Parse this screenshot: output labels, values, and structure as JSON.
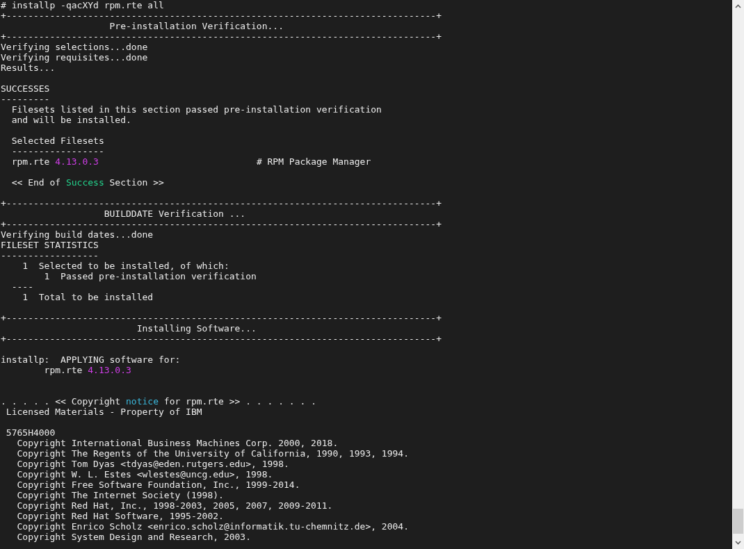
{
  "terminal": {
    "lines": [
      {
        "kind": "text",
        "segments": [
          {
            "text": "# installp -qacXYd rpm.rte all"
          }
        ]
      },
      {
        "kind": "text",
        "segments": [
          {
            "text": "+-------------------------------------------------------------------------------+"
          }
        ]
      },
      {
        "kind": "text",
        "segments": [
          {
            "text": "                    Pre-installation Verification..."
          }
        ]
      },
      {
        "kind": "text",
        "segments": [
          {
            "text": "+-------------------------------------------------------------------------------+"
          }
        ]
      },
      {
        "kind": "text",
        "segments": [
          {
            "text": "Verifying selections...done"
          }
        ]
      },
      {
        "kind": "text",
        "segments": [
          {
            "text": "Verifying requisites...done"
          }
        ]
      },
      {
        "kind": "text",
        "segments": [
          {
            "text": "Results..."
          }
        ]
      },
      {
        "kind": "blank"
      },
      {
        "kind": "text",
        "segments": [
          {
            "text": "SUCCESSES"
          }
        ]
      },
      {
        "kind": "text",
        "segments": [
          {
            "text": "---------"
          }
        ]
      },
      {
        "kind": "text",
        "segments": [
          {
            "text": "  Filesets listed in this section passed pre-installation verification"
          }
        ]
      },
      {
        "kind": "text",
        "segments": [
          {
            "text": "  and will be installed."
          }
        ]
      },
      {
        "kind": "blank"
      },
      {
        "kind": "text",
        "segments": [
          {
            "text": "  Selected Filesets"
          }
        ]
      },
      {
        "kind": "text",
        "segments": [
          {
            "text": "  -----------------"
          }
        ]
      },
      {
        "kind": "text",
        "segments": [
          {
            "text": "  rpm.rte "
          },
          {
            "text": "4.13.0.3",
            "color": "#d03ee8"
          },
          {
            "text": "                             # RPM Package Manager"
          }
        ]
      },
      {
        "kind": "blank"
      },
      {
        "kind": "text",
        "segments": [
          {
            "text": "  << End of "
          },
          {
            "text": "Success",
            "color": "#23d18b"
          },
          {
            "text": " Section >>"
          }
        ]
      },
      {
        "kind": "blank"
      },
      {
        "kind": "text",
        "segments": [
          {
            "text": "+-------------------------------------------------------------------------------+"
          }
        ]
      },
      {
        "kind": "text",
        "segments": [
          {
            "text": "                   BUILDDATE Verification ..."
          }
        ]
      },
      {
        "kind": "text",
        "segments": [
          {
            "text": "+-------------------------------------------------------------------------------+"
          }
        ]
      },
      {
        "kind": "text",
        "segments": [
          {
            "text": "Verifying build dates...done"
          }
        ]
      },
      {
        "kind": "text",
        "segments": [
          {
            "text": "FILESET STATISTICS"
          }
        ]
      },
      {
        "kind": "text",
        "segments": [
          {
            "text": "------------------"
          }
        ]
      },
      {
        "kind": "text",
        "segments": [
          {
            "text": "    1  Selected to be installed, of which:"
          }
        ]
      },
      {
        "kind": "text",
        "segments": [
          {
            "text": "        1  Passed pre-installation verification"
          }
        ]
      },
      {
        "kind": "text",
        "segments": [
          {
            "text": "  ----"
          }
        ]
      },
      {
        "kind": "text",
        "segments": [
          {
            "text": "    1  Total to be installed"
          }
        ]
      },
      {
        "kind": "blank"
      },
      {
        "kind": "text",
        "segments": [
          {
            "text": "+-------------------------------------------------------------------------------+"
          }
        ]
      },
      {
        "kind": "text",
        "segments": [
          {
            "text": "                         Installing Software..."
          }
        ]
      },
      {
        "kind": "text",
        "segments": [
          {
            "text": "+-------------------------------------------------------------------------------+"
          }
        ]
      },
      {
        "kind": "blank"
      },
      {
        "kind": "text",
        "segments": [
          {
            "text": "installp:  APPLYING software for:"
          }
        ]
      },
      {
        "kind": "text",
        "segments": [
          {
            "text": "        rpm.rte "
          },
          {
            "text": "4.13.0.3",
            "color": "#d03ee8"
          }
        ]
      },
      {
        "kind": "blank"
      },
      {
        "kind": "blank"
      },
      {
        "kind": "text",
        "segments": [
          {
            "text": ". . . . . << Copyright "
          },
          {
            "text": "notice",
            "color": "#3bb8dc"
          },
          {
            "text": " for rpm.rte >> . . . . . . ."
          }
        ]
      },
      {
        "kind": "text",
        "segments": [
          {
            "text": " Licensed Materials - Property of IBM"
          }
        ]
      },
      {
        "kind": "blank"
      },
      {
        "kind": "text",
        "segments": [
          {
            "text": " 5765H4000"
          }
        ]
      },
      {
        "kind": "text",
        "segments": [
          {
            "text": "   Copyright International Business Machines Corp. 2000, 2018."
          }
        ]
      },
      {
        "kind": "text",
        "segments": [
          {
            "text": "   Copyright The Regents of the University of California, 1990, 1993, 1994."
          }
        ]
      },
      {
        "kind": "text",
        "segments": [
          {
            "text": "   Copyright Tom Dyas <tdyas@eden.rutgers.edu>, 1998."
          }
        ]
      },
      {
        "kind": "text",
        "segments": [
          {
            "text": "   Copyright W. L. Estes <wlestes@uncg.edu>, 1998."
          }
        ]
      },
      {
        "kind": "text",
        "segments": [
          {
            "text": "   Copyright Free Software Foundation, Inc., 1999-2014."
          }
        ]
      },
      {
        "kind": "text",
        "segments": [
          {
            "text": "   Copyright The Internet Society (1998)."
          }
        ]
      },
      {
        "kind": "text",
        "segments": [
          {
            "text": "   Copyright Red Hat, Inc., 1998-2003, 2005, 2007, 2009-2011."
          }
        ]
      },
      {
        "kind": "text",
        "segments": [
          {
            "text": "   Copyright Red Hat Software, 1995-2002."
          }
        ]
      },
      {
        "kind": "text",
        "segments": [
          {
            "text": "   Copyright Enrico Scholz <enrico.scholz@informatik.tu-chemnitz.de>, 2004."
          }
        ]
      },
      {
        "kind": "text",
        "segments": [
          {
            "text": "   Copyright System Design and Research, 2003."
          }
        ]
      }
    ]
  }
}
